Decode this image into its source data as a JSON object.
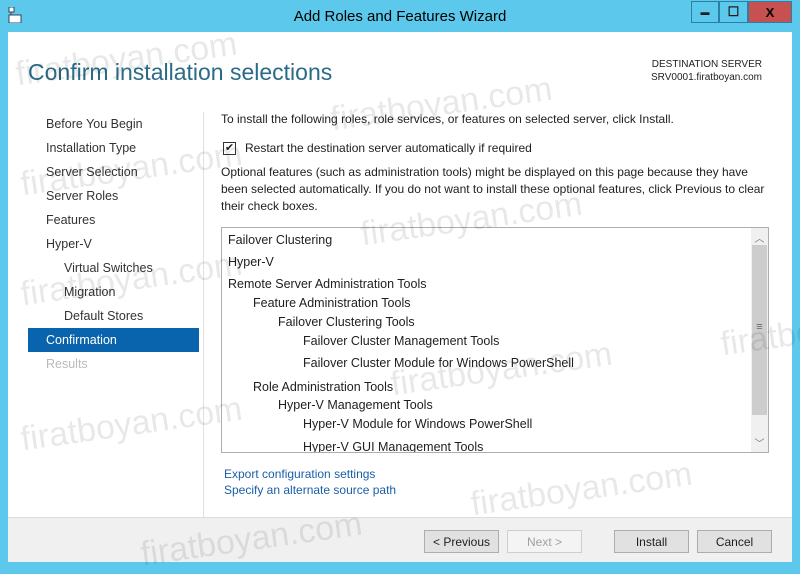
{
  "window": {
    "title": "Add Roles and Features Wizard",
    "minimize": "▬",
    "maximize": "☐",
    "close": "X"
  },
  "header": {
    "title": "Confirm installation selections",
    "dest_label": "DESTINATION SERVER",
    "dest_server": "SRV0001.firatboyan.com"
  },
  "nav": [
    {
      "label": "Before You Begin",
      "level": 0,
      "state": "normal"
    },
    {
      "label": "Installation Type",
      "level": 0,
      "state": "normal"
    },
    {
      "label": "Server Selection",
      "level": 0,
      "state": "normal"
    },
    {
      "label": "Server Roles",
      "level": 0,
      "state": "normal"
    },
    {
      "label": "Features",
      "level": 0,
      "state": "normal"
    },
    {
      "label": "Hyper-V",
      "level": 0,
      "state": "normal"
    },
    {
      "label": "Virtual Switches",
      "level": 1,
      "state": "normal"
    },
    {
      "label": "Migration",
      "level": 1,
      "state": "normal"
    },
    {
      "label": "Default Stores",
      "level": 1,
      "state": "normal"
    },
    {
      "label": "Confirmation",
      "level": 0,
      "state": "active"
    },
    {
      "label": "Results",
      "level": 0,
      "state": "disabled"
    }
  ],
  "main": {
    "intro": "To install the following roles, role services, or features on selected server, click Install.",
    "restart_checkbox": {
      "label": "Restart the destination server automatically if required",
      "checked": true,
      "mark": "✔"
    },
    "optional_note": "Optional features (such as administration tools) might be displayed on this page because they have been selected automatically. If you do not want to install these optional features, click Previous to clear their check boxes.",
    "features": [
      {
        "label": "Failover Clustering",
        "level": 0
      },
      {
        "label": "Hyper-V",
        "level": 0
      },
      {
        "label": "Remote Server Administration Tools",
        "level": 0
      },
      {
        "label": "Feature Administration Tools",
        "level": 1
      },
      {
        "label": "Failover Clustering Tools",
        "level": 2
      },
      {
        "label": "Failover Cluster Management Tools",
        "level": 3
      },
      {
        "label": "Failover Cluster Module for Windows PowerShell",
        "level": 3
      },
      {
        "label": "Role Administration Tools",
        "level": 1
      },
      {
        "label": "Hyper-V Management Tools",
        "level": 2
      },
      {
        "label": "Hyper-V Module for Windows PowerShell",
        "level": 3
      },
      {
        "label": "Hyper-V GUI Management Tools",
        "level": 3
      }
    ],
    "links": {
      "export": "Export configuration settings",
      "alt_source": "Specify an alternate source path"
    }
  },
  "footer": {
    "previous": "< Previous",
    "next": "Next >",
    "install": "Install",
    "cancel": "Cancel"
  },
  "watermark": "firatboyan.com",
  "colors": {
    "titlebar": "#5bc8ec",
    "accent": "#0a64ad",
    "close": "#c75050"
  }
}
